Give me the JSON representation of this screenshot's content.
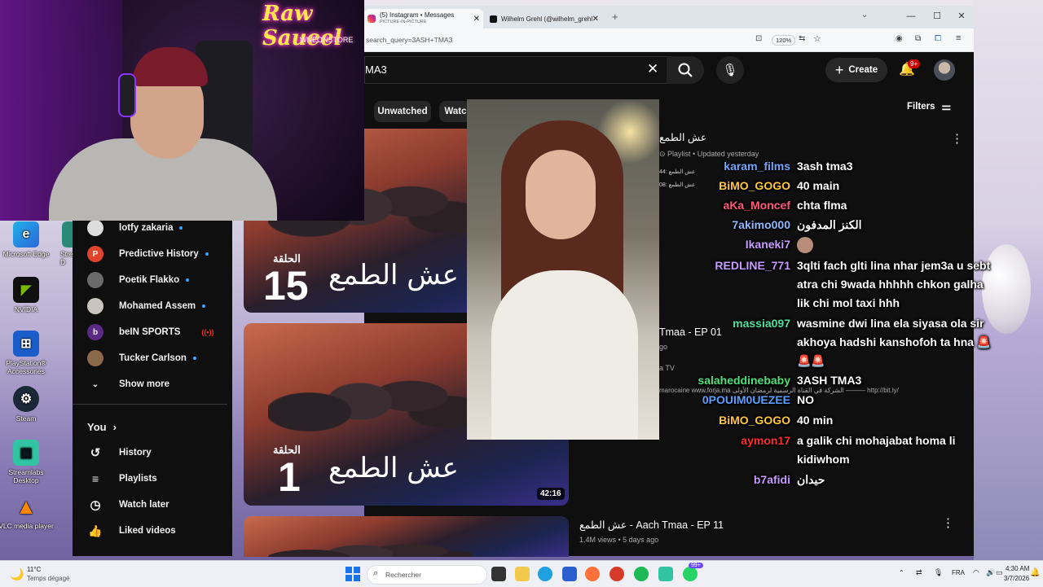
{
  "browser": {
    "tabs": [
      {
        "title": "(5) Instagram • Messages",
        "subtitle": "PICTURE-IN-PICTURE"
      },
      {
        "title": "Wilhelm Grehl (@wilhelm_grehl"
      }
    ],
    "url": "search_query=3ASH+TMA3",
    "zoom": "120%"
  },
  "youtube": {
    "search_value": "MA3",
    "create_label": "Create",
    "notif_count": "9+",
    "chips": [
      "Unwatched",
      "Watc"
    ],
    "filters_label": "Filters",
    "sidebar": {
      "subscriptions": [
        {
          "name": "lotfy zakaria"
        },
        {
          "name": "Predictive History"
        },
        {
          "name": "Poetik Flakko"
        },
        {
          "name": "Mohamed Assem"
        },
        {
          "name": "beIN SPORTS"
        },
        {
          "name": "Tucker Carlson"
        }
      ],
      "show_more": "Show more",
      "you_label": "You",
      "you_items": [
        "History",
        "Playlists",
        "Watch later",
        "Liked videos"
      ]
    },
    "results": [
      {
        "ep_label": "الحلقة",
        "ep_number": "15",
        "show_title": "عش الطمع"
      },
      {
        "ep_label": "الحلقة",
        "ep_number": "1",
        "show_title": "عش الطمع",
        "duration": "42:16"
      },
      {
        "title": "عش الطمع - Aach Tmaa - EP 11",
        "meta": "1.4M views • 5 days ago"
      }
    ],
    "playlist": {
      "title": "عش الطمع",
      "meta": "Playlist • Updated yesterday",
      "items": [
        "عش الطمع :44",
        "عش الطمع :08"
      ]
    },
    "fragments": {
      "ep01": "Tmaa - EP 01",
      "ago": "go",
      "channel": "a TV",
      "desc": "marocaine www.forja.ma الشركة في القناة الرسمية لرمضان الأولى ——— http://bit.ly/"
    }
  },
  "chat": [
    {
      "user": "karam_films",
      "msg": "3ash tma3",
      "color": "#6fa8ff"
    },
    {
      "user": "BiMO_GOGO",
      "msg": "40 main",
      "color": "#ffc83d"
    },
    {
      "user": "aKa_Moncef",
      "msg": "chta flma",
      "color": "#ff5a7a"
    },
    {
      "user": "7akimo000",
      "msg": "الكنز المدفون",
      "color": "#8fb8ff"
    },
    {
      "user": "Ikaneki7",
      "msg": "",
      "color": "#c79bff"
    },
    {
      "user": "REDLINE_771",
      "msg": "3qlti fach glti lina nhar jem3a u sebt atra chi 9wada hhhhh chkon galha lik chi mol taxi hhh",
      "color": "#c79bff"
    },
    {
      "user": "massia097",
      "msg": "wasmine dwi lina ela siyasa ola sir akhoya hadshi kanshofoh ta hna 🚨🚨🚨",
      "color": "#4fe0a0"
    },
    {
      "user": "salaheddinebaby",
      "msg": "3ASH TMA3",
      "color": "#4fe07a"
    },
    {
      "user": "0POUIM0UEZEE",
      "msg": "NO",
      "color": "#5aa0ff"
    },
    {
      "user": "BiMO_GOGO",
      "msg": "40 min",
      "color": "#ffc83d"
    },
    {
      "user": "aymon17",
      "msg": "a galik chi mohajabat homa li kidiwhom",
      "color": "#ff3030"
    },
    {
      "user": "b7afidi",
      "msg": "حيدان",
      "color": "#c79bff"
    }
  ],
  "webcam": {
    "neon_text": "Raw Saueel",
    "sub_text": "WNEONSTORE"
  },
  "desktop_icons": [
    "Microsoft Edge",
    "NVIDIA",
    "PlayStation® Accessories",
    "Steam",
    "Streamlabs Desktop",
    "VLC media player",
    "Stre",
    "D"
  ],
  "taskbar": {
    "weather_temp": "11°C",
    "weather_desc": "Temps dégagé",
    "search_placeholder": "Rechercher",
    "lang": "FRA",
    "time": "4:30 AM",
    "date": "3/7/2026",
    "badge": "99+"
  }
}
